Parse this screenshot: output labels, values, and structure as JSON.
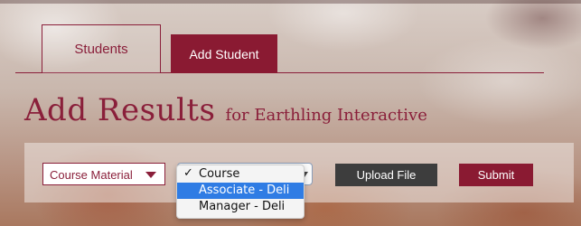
{
  "tabs": {
    "students_label": "Students",
    "add_student_label": "Add Student"
  },
  "heading": {
    "title": "Add Results",
    "subtitle": "for Earthling Interactive"
  },
  "form": {
    "material_select": {
      "value": "Course Material"
    },
    "course_select": {
      "options": [
        {
          "label": "Course",
          "checked": true,
          "highlighted": false
        },
        {
          "label": "Associate - Deli",
          "checked": false,
          "highlighted": true
        },
        {
          "label": "Manager - Deli",
          "checked": false,
          "highlighted": false
        }
      ]
    },
    "upload_label": "Upload File",
    "submit_label": "Submit"
  },
  "colors": {
    "brand": "#8a1a32",
    "upload_button": "#3d3d3d",
    "highlight": "#2f7ce4"
  },
  "icons": {
    "check": "✓",
    "dropdown_caret": "chevron-down-icon"
  }
}
